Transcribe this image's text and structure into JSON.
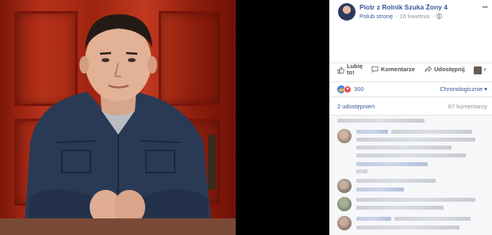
{
  "post": {
    "page_name": "Piotr z Rolnik Szuka Żony 4",
    "like_page": "Polub stronę",
    "separator": "·",
    "date": "16 kwietnia",
    "separator2": "·",
    "more": "•••"
  },
  "actions": {
    "like_line1": "Lubię",
    "like_line2": "to!",
    "comment": "Komentarze",
    "share": "Udostępnij"
  },
  "reactions": {
    "like_glyph": "👍",
    "love_glyph": "♥",
    "count": "300",
    "sort": "Chronologicznie ▾"
  },
  "stats": {
    "shares": "2 udostępnień",
    "comments": "67 komentarzy"
  },
  "photo": {
    "description_icon": "man-portrait-photo"
  },
  "colors": {
    "link": "#365899",
    "muted": "#90949c",
    "like_blue": "#3b7cf3",
    "love_red": "#f0465b"
  }
}
